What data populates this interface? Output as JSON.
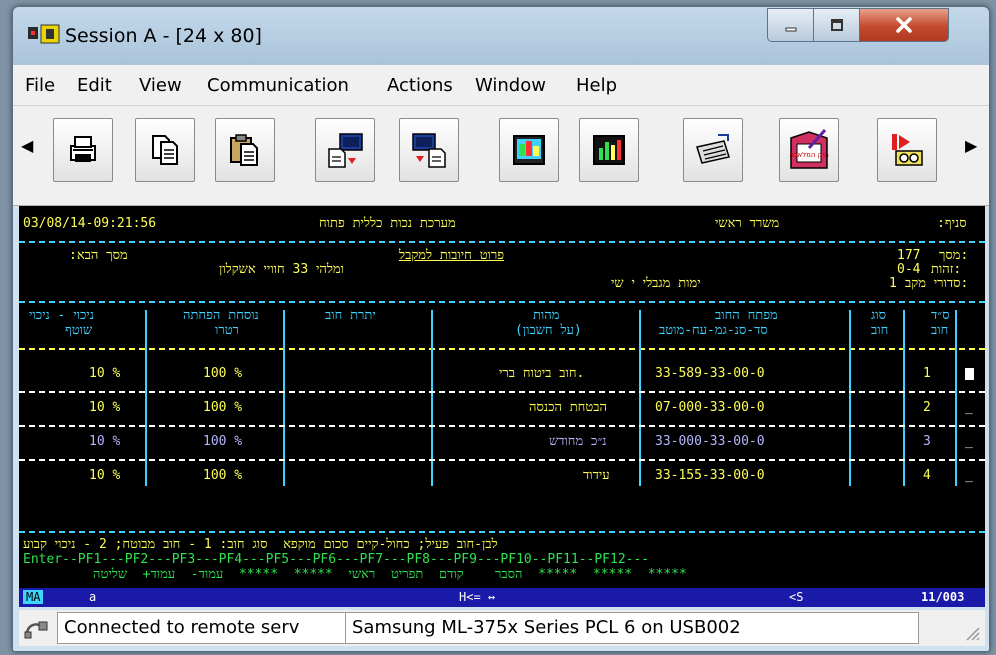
{
  "window": {
    "title": "Session A - [24 x 80]"
  },
  "menu": [
    "File",
    "Edit",
    "View",
    "Communication",
    "Actions",
    "Window",
    "Help"
  ],
  "toolbar": {
    "buttons": [
      "print-icon",
      "copy-icon",
      "paste-icon",
      "send-file-icon",
      "receive-file-icon",
      "display-icon",
      "chart-icon",
      "keyboard-map-icon",
      "macro-edit-icon",
      "macro-record-icon"
    ],
    "badge": "תיק המלאכה"
  },
  "screen": {
    "timestamp": "03/08/14-09:21:56",
    "system_title": "מערכת נכות כללית פתוח",
    "office": "משרד ראשי",
    "branch_label": ":סניף",
    "next_screen_label": ":מסך הבא",
    "report_title": "פרוט חיובות למקבל",
    "screen_label": "מסך:",
    "screen_number": "177",
    "id_label": "זהות:",
    "id_value": "0-4",
    "serial_label": "סדורי מקב:",
    "serial_value": "1",
    "name_line": "ומלהי 33 חוויי אשקלון",
    "partial_line": "ימות מגבלי י שי",
    "headers": {
      "deduction_percent": "ניכוי - ניכוי",
      "deduction_formula": "נוסחת הפחתה",
      "retro": "רטרו",
      "current": "שוטף",
      "debt_balance": "יתרת חוב",
      "essence": "מהות",
      "account": "(על חשבון)",
      "debt_key": "מפתח החוב",
      "debt_key_sub": "סד-סנ-גמ-עח-מוטב",
      "debt_type": "סוג",
      "debt_type_sub": "חוב",
      "debt_no": "ס״ד",
      "debt_no_sub": "חוב"
    },
    "rows": [
      {
        "deduction": "10 %",
        "retro": "100 %",
        "essence": "חוב ביטוח ברי.",
        "key": "33-589-33-00-0",
        "no": "1"
      },
      {
        "deduction": "10 %",
        "retro": "100 %",
        "essence": "הבטחת הכנסה",
        "key": "07-000-33-00-0",
        "no": "2"
      },
      {
        "deduction": "10 %",
        "retro": "100 %",
        "essence": "נ״כ מחודש",
        "key": "33-000-33-00-0",
        "no": "3"
      },
      {
        "deduction": "10 %",
        "retro": "100 %",
        "essence": "עידוד",
        "key": "33-155-33-00-0",
        "no": "4"
      }
    ],
    "legend_line": "לבן-חוב פעיל; כחול-קיים סכום מוקפא  סוג חוב: 1 - חוב מבוטח; 2 - ניכוי קבוע",
    "pf_line": "Enter--PF1---PF2---PF3---PF4---PF5---PF6---PF7---PF8---PF9---PF10--PF11--PF12---",
    "pf_labels": "הסבר    קודם  תפריט  ראשי  *****  *****  עמוד-  עמוד+  שליטה  *****  *****  *****"
  },
  "oia": {
    "mode": "MA",
    "session": "a",
    "arrows": "H<= ↔",
    "shift": "<S",
    "position": "11/003"
  },
  "statusbar": {
    "connection": "Connected to remote serv",
    "printer": "Samsung ML-375x Series PCL 6 on USB002"
  }
}
